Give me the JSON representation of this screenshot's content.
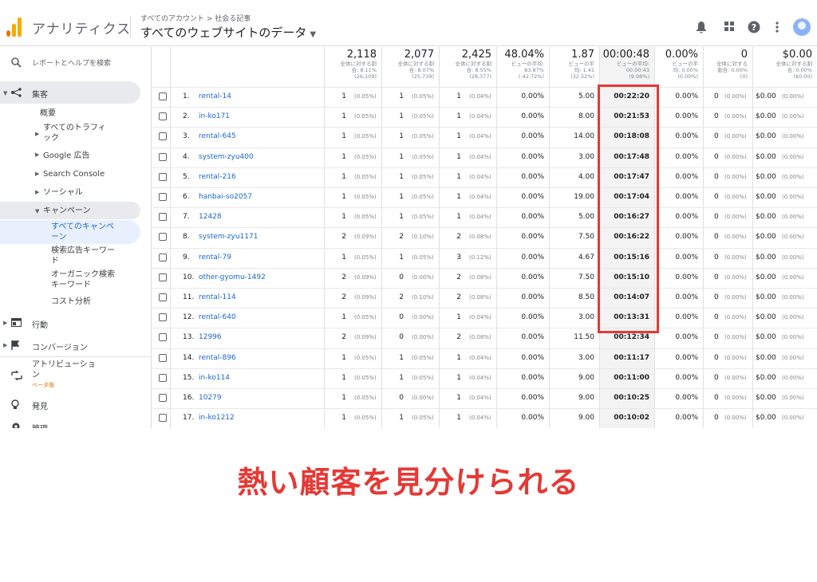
{
  "header": {
    "app_title": "アナリティクス",
    "breadcrumb": "すべてのアカウント > 社会る記事",
    "view_title": "すべてのウェブサイトのデータ"
  },
  "sidebar": {
    "search_label": "レポートとヘルプを検索",
    "acquisition": "集客",
    "overview": "概要",
    "all_traffic": "すべてのトラフィ\nック",
    "google_ads": "Google 広告",
    "search_console": "Search Console",
    "social": "ソーシャル",
    "campaigns": "キャンペーン",
    "all_campaigns": "すべてのキャンペ\nーン",
    "paid_keywords": "検索広告キーワー\nド",
    "organic_keywords": "オーガニック検索\nキーワード",
    "cost_analysis": "コスト分析",
    "behavior": "行動",
    "conversions": "コンバージョン",
    "attribution": "アトリビューショ\nン",
    "beta": "ベータ版",
    "discover": "発見",
    "admin": "管理"
  },
  "table": {
    "totals": [
      {
        "big": "2,118",
        "small": "全体に対する割\n合: 8.11%\n(26,109)"
      },
      {
        "big": "2,077",
        "small": "全体に対する割\n合: 8.07%\n(25,739)"
      },
      {
        "big": "2,425",
        "small": "全体に対する割\n合: 8.55%\n(28,377)"
      },
      {
        "big": "48.04%",
        "small": "ビューの平均:\n83.87%\n(-42.72%)"
      },
      {
        "big": "1.87",
        "small": "ビューの平\n均: 1.41\n(32.52%)"
      },
      {
        "big": "00:00:48",
        "small": "ビューの平均:\n00:00:43\n(9.98%)"
      },
      {
        "big": "0.00%",
        "small": "ビューの平\n均: 0.00%\n(0.00%)"
      },
      {
        "big": "0",
        "small": "全体に対する\n割合: 0.00%\n(0)"
      },
      {
        "big": "$0.00",
        "small": "全体に対する割\n合: 0.00%\n($0.00)"
      }
    ],
    "rows": [
      {
        "n": "1.",
        "name": "rental-14",
        "a": "1",
        "ap": "(0.05%)",
        "b": "1",
        "bp": "(0.05%)",
        "c": "1",
        "cp": "(0.04%)",
        "d": "0.00%",
        "e": "5.00",
        "f": "00:22:20",
        "g": "0.00%",
        "h": "0",
        "hp": "(0.00%)",
        "i": "$0.00",
        "ip": "(0.00%)"
      },
      {
        "n": "2.",
        "name": "in-ko171",
        "a": "1",
        "ap": "(0.05%)",
        "b": "1",
        "bp": "(0.05%)",
        "c": "1",
        "cp": "(0.04%)",
        "d": "0.00%",
        "e": "8.00",
        "f": "00:21:53",
        "g": "0.00%",
        "h": "0",
        "hp": "(0.00%)",
        "i": "$0.00",
        "ip": "(0.00%)"
      },
      {
        "n": "3.",
        "name": "rental-645",
        "a": "1",
        "ap": "(0.05%)",
        "b": "1",
        "bp": "(0.05%)",
        "c": "1",
        "cp": "(0.04%)",
        "d": "0.00%",
        "e": "14.00",
        "f": "00:18:08",
        "g": "0.00%",
        "h": "0",
        "hp": "(0.00%)",
        "i": "$0.00",
        "ip": "(0.00%)"
      },
      {
        "n": "4.",
        "name": "system-zyu400",
        "a": "1",
        "ap": "(0.05%)",
        "b": "1",
        "bp": "(0.05%)",
        "c": "1",
        "cp": "(0.04%)",
        "d": "0.00%",
        "e": "3.00",
        "f": "00:17:48",
        "g": "0.00%",
        "h": "0",
        "hp": "(0.00%)",
        "i": "$0.00",
        "ip": "(0.00%)"
      },
      {
        "n": "5.",
        "name": "rental-216",
        "a": "1",
        "ap": "(0.05%)",
        "b": "1",
        "bp": "(0.05%)",
        "c": "1",
        "cp": "(0.04%)",
        "d": "0.00%",
        "e": "4.00",
        "f": "00:17:47",
        "g": "0.00%",
        "h": "0",
        "hp": "(0.00%)",
        "i": "$0.00",
        "ip": "(0.00%)"
      },
      {
        "n": "6.",
        "name": "hanbai-so2057",
        "a": "1",
        "ap": "(0.05%)",
        "b": "1",
        "bp": "(0.05%)",
        "c": "1",
        "cp": "(0.04%)",
        "d": "0.00%",
        "e": "19.00",
        "f": "00:17:04",
        "g": "0.00%",
        "h": "0",
        "hp": "(0.00%)",
        "i": "$0.00",
        "ip": "(0.00%)"
      },
      {
        "n": "7.",
        "name": "12428",
        "a": "1",
        "ap": "(0.05%)",
        "b": "1",
        "bp": "(0.05%)",
        "c": "1",
        "cp": "(0.04%)",
        "d": "0.00%",
        "e": "5.00",
        "f": "00:16:27",
        "g": "0.00%",
        "h": "0",
        "hp": "(0.00%)",
        "i": "$0.00",
        "ip": "(0.00%)"
      },
      {
        "n": "8.",
        "name": "system-zyu1171",
        "a": "2",
        "ap": "(0.09%)",
        "b": "2",
        "bp": "(0.10%)",
        "c": "2",
        "cp": "(0.08%)",
        "d": "0.00%",
        "e": "7.50",
        "f": "00:16:22",
        "g": "0.00%",
        "h": "0",
        "hp": "(0.00%)",
        "i": "$0.00",
        "ip": "(0.00%)"
      },
      {
        "n": "9.",
        "name": "rental-79",
        "a": "1",
        "ap": "(0.05%)",
        "b": "1",
        "bp": "(0.05%)",
        "c": "3",
        "cp": "(0.12%)",
        "d": "0.00%",
        "e": "4.67",
        "f": "00:15:16",
        "g": "0.00%",
        "h": "0",
        "hp": "(0.00%)",
        "i": "$0.00",
        "ip": "(0.00%)"
      },
      {
        "n": "10.",
        "name": "other-gyomu-1492",
        "a": "2",
        "ap": "(0.09%)",
        "b": "0",
        "bp": "(0.00%)",
        "c": "2",
        "cp": "(0.08%)",
        "d": "0.00%",
        "e": "7.50",
        "f": "00:15:10",
        "g": "0.00%",
        "h": "0",
        "hp": "(0.00%)",
        "i": "$0.00",
        "ip": "(0.00%)"
      },
      {
        "n": "11.",
        "name": "rental-114",
        "a": "2",
        "ap": "(0.09%)",
        "b": "2",
        "bp": "(0.10%)",
        "c": "2",
        "cp": "(0.08%)",
        "d": "0.00%",
        "e": "8.50",
        "f": "00:14:07",
        "g": "0.00%",
        "h": "0",
        "hp": "(0.00%)",
        "i": "$0.00",
        "ip": "(0.00%)"
      },
      {
        "n": "12.",
        "name": "rental-640",
        "a": "1",
        "ap": "(0.05%)",
        "b": "0",
        "bp": "(0.00%)",
        "c": "1",
        "cp": "(0.04%)",
        "d": "0.00%",
        "e": "3.00",
        "f": "00:13:31",
        "g": "0.00%",
        "h": "0",
        "hp": "(0.00%)",
        "i": "$0.00",
        "ip": "(0.00%)"
      },
      {
        "n": "13.",
        "name": "12996",
        "a": "2",
        "ap": "(0.09%)",
        "b": "0",
        "bp": "(0.00%)",
        "c": "2",
        "cp": "(0.08%)",
        "d": "0.00%",
        "e": "11.50",
        "f": "00:12:34",
        "g": "0.00%",
        "h": "0",
        "hp": "(0.00%)",
        "i": "$0.00",
        "ip": "(0.00%)"
      },
      {
        "n": "14.",
        "name": "rental-896",
        "a": "1",
        "ap": "(0.05%)",
        "b": "1",
        "bp": "(0.05%)",
        "c": "1",
        "cp": "(0.04%)",
        "d": "0.00%",
        "e": "3.00",
        "f": "00:11:17",
        "g": "0.00%",
        "h": "0",
        "hp": "(0.00%)",
        "i": "$0.00",
        "ip": "(0.00%)"
      },
      {
        "n": "15.",
        "name": "in-ko114",
        "a": "1",
        "ap": "(0.05%)",
        "b": "1",
        "bp": "(0.05%)",
        "c": "1",
        "cp": "(0.04%)",
        "d": "0.00%",
        "e": "9.00",
        "f": "00:11:00",
        "g": "0.00%",
        "h": "0",
        "hp": "(0.00%)",
        "i": "$0.00",
        "ip": "(0.00%)"
      },
      {
        "n": "16.",
        "name": "10279",
        "a": "1",
        "ap": "(0.05%)",
        "b": "0",
        "bp": "(0.00%)",
        "c": "1",
        "cp": "(0.04%)",
        "d": "0.00%",
        "e": "9.00",
        "f": "00:10:25",
        "g": "0.00%",
        "h": "0",
        "hp": "(0.00%)",
        "i": "$0.00",
        "ip": "(0.00%)"
      },
      {
        "n": "17.",
        "name": "in-ko1212",
        "a": "1",
        "ap": "(0.05%)",
        "b": "1",
        "bp": "(0.05%)",
        "c": "1",
        "cp": "(0.04%)",
        "d": "0.00%",
        "e": "9.00",
        "f": "00:10:02",
        "g": "0.00%",
        "h": "0",
        "hp": "(0.00%)",
        "i": "$0.00",
        "ip": "(0.00%)"
      }
    ]
  },
  "caption": "熱い顧客を見分けられる",
  "colors": {
    "accent": "#e53935",
    "link": "#1967d2",
    "logo": "#f9ab00"
  },
  "icons": [
    "search-icon",
    "acquisition-icon",
    "behavior-icon",
    "flag-icon",
    "attribution-icon",
    "lightbulb-icon",
    "gear-icon",
    "bell-icon",
    "apps-icon",
    "help-icon",
    "more-icon"
  ]
}
